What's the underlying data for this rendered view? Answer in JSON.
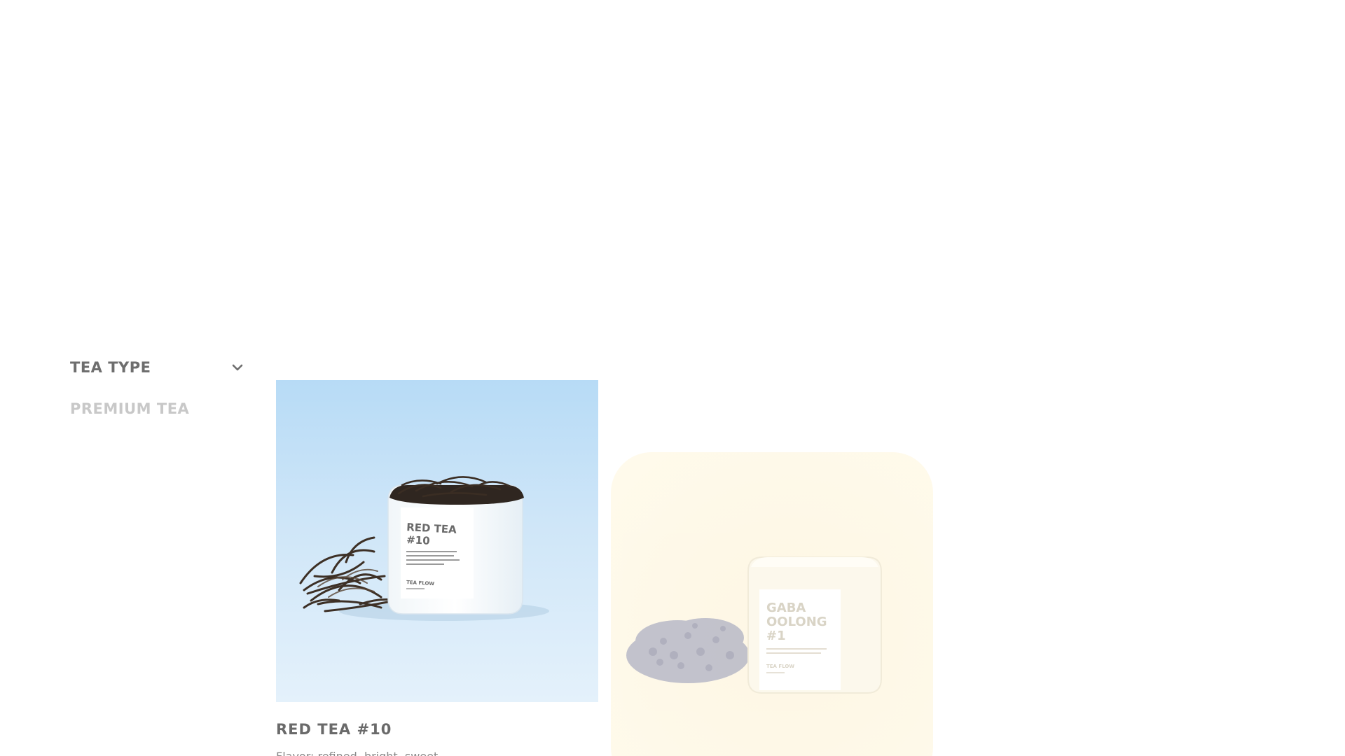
{
  "filters": {
    "tea_type": {
      "title": "TEA TYPE",
      "icon": "chevron-down-icon",
      "options": [
        "PREMIUM TEA"
      ]
    }
  },
  "products": [
    {
      "name": "RED TEA #10",
      "flavor": "Flavor: refined, bright, sweet",
      "tin": {
        "label_title": "RED TEA\n#10",
        "brand": "TEA FLOW"
      },
      "background_color": "#c8e3f7"
    },
    {
      "tin": {
        "label_title": "GABA\nOOLONG\n#1",
        "brand": "TEA FLOW"
      },
      "background_color": "#fdf6e4"
    }
  ],
  "colors": {
    "heading_text": "#6e6e6e",
    "muted_text": "#c8c8c8",
    "body_text": "#8a8a8a"
  }
}
